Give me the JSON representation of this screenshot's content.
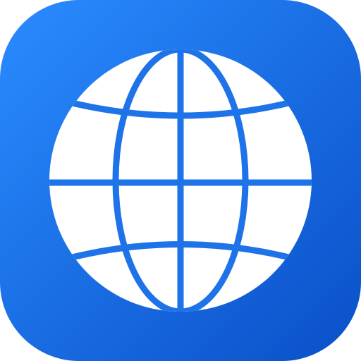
{
  "app_icon": {
    "icon": "globe-icon",
    "colors": {
      "gradient_start": "#2A8CFF",
      "gradient_end": "#0A4FC8",
      "globe_fill": "#FFFFFF",
      "grid_line": "#1E73E8"
    }
  }
}
